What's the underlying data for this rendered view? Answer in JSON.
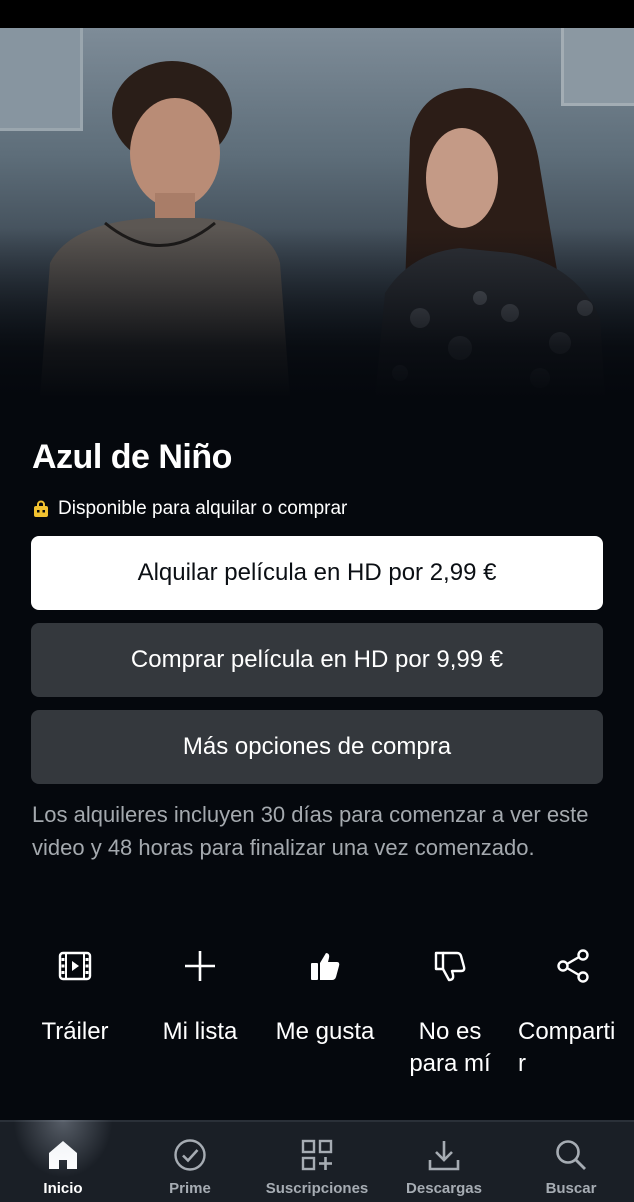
{
  "movie": {
    "title": "Azul de Niño",
    "availability": "Disponible para alquilar o comprar"
  },
  "buttons": {
    "rent": "Alquilar película en HD por 2,99 €",
    "buy": "Comprar película en HD por 9,99 €",
    "more": "Más opciones de compra"
  },
  "note": "Los alquileres incluyen 30 días para comenzar a ver este video y 48 horas para finalizar una vez comenzado.",
  "actions": [
    {
      "label": "Tráiler",
      "icon": "film-icon"
    },
    {
      "label": "Mi lista",
      "icon": "plus-icon"
    },
    {
      "label": "Me gusta",
      "icon": "thumbs-up-icon"
    },
    {
      "label": "No es\npara mí",
      "icon": "thumbs-down-icon"
    },
    {
      "label": "Comparti\nr",
      "icon": "share-icon"
    }
  ],
  "nav": [
    {
      "label": "Inicio",
      "icon": "home-icon",
      "active": true
    },
    {
      "label": "Prime",
      "icon": "check-circle-icon",
      "active": false
    },
    {
      "label": "Suscripciones",
      "icon": "grid-plus-icon",
      "active": false
    },
    {
      "label": "Descargas",
      "icon": "download-icon",
      "active": false
    },
    {
      "label": "Buscar",
      "icon": "search-icon",
      "active": false
    }
  ],
  "colors": {
    "background": "#05080d",
    "primary_button": "#ffffff",
    "secondary_button": "#34383d",
    "bag_icon": "#f2c230",
    "navbar": "#1a1f26"
  }
}
